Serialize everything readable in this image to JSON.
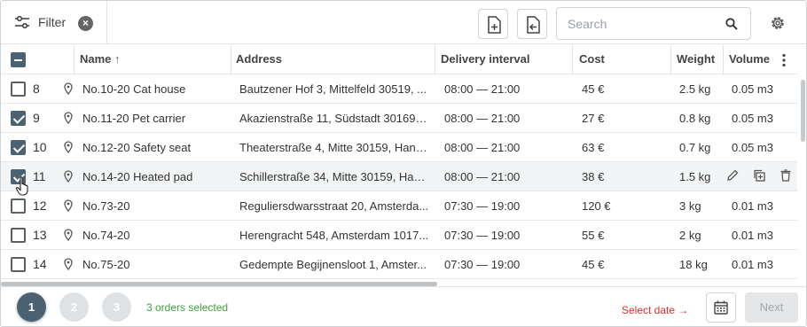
{
  "toolbar": {
    "filter_label": "Filter",
    "filter_clear_icon": "close-circle-icon",
    "search_placeholder": "Search",
    "search_icon": "search-icon",
    "settings_icon": "gear-icon",
    "buttons": [
      "add-document-icon",
      "import-document-icon"
    ]
  },
  "table": {
    "columns": [
      {
        "label": "Name",
        "sort": "↑"
      },
      {
        "label": "Address"
      },
      {
        "label": "Delivery interval"
      },
      {
        "label": "Cost"
      },
      {
        "label": "Weight"
      },
      {
        "label": "Volume"
      }
    ],
    "rows": [
      {
        "num": "8",
        "checked": false,
        "name": "No.10-20 Cat house",
        "address": "Bautzener Hof 3, Mittelfeld 30519, ...",
        "interval": "08:00 — 21:00",
        "cost": "45 €",
        "weight": "2.5 kg",
        "volume": "0.05 m3"
      },
      {
        "num": "9",
        "checked": true,
        "name": "No.11-20 Pet carrier",
        "address": "Akazienstraße 11, Südstadt 30169, ...",
        "interval": "08:00 — 21:00",
        "cost": "27 €",
        "weight": "0.8 kg",
        "volume": "0.05 m3"
      },
      {
        "num": "10",
        "checked": true,
        "name": "No.12-20 Safety seat",
        "address": "Theaterstraße 4, Mitte 30159, Hann...",
        "interval": "08:00 — 21:00",
        "cost": "63 €",
        "weight": "0.7 kg",
        "volume": "0.05 m3"
      },
      {
        "num": "11",
        "checked": true,
        "name": "No.14-20 Heated pad",
        "address": "Schillerstraße 34, Mitte 30159, Han...",
        "interval": "08:00 — 21:00",
        "cost": "38 €",
        "weight": "1.5 kg",
        "volume": ""
      },
      {
        "num": "12",
        "checked": false,
        "name": "No.73-20",
        "address": "Reguliersdwarsstraat 20, Amsterda...",
        "interval": "07:30 — 19:00",
        "cost": "120 €",
        "weight": "3 kg",
        "volume": "0.01 m3"
      },
      {
        "num": "13",
        "checked": false,
        "name": "No.74-20",
        "address": "Herengracht 548, Amsterdam 1017...",
        "interval": "07:30 — 19:00",
        "cost": "55 €",
        "weight": "2 kg",
        "volume": "0.01 m3"
      },
      {
        "num": "14",
        "checked": false,
        "name": "No.75-20",
        "address": "Gedempte Begijnensloot 1, Amster...",
        "interval": "07:30 — 19:00",
        "cost": "45 €",
        "weight": "18 kg",
        "volume": "0.01 m3"
      }
    ],
    "hover_row_actions": [
      "edit-icon",
      "copy-icon",
      "trash-icon"
    ]
  },
  "footer": {
    "steps": [
      "1",
      "2",
      "3"
    ],
    "active_step": "1",
    "orders_selected": "3 orders selected",
    "select_date": "Select date →",
    "calendar_icon": "calendar-icon",
    "next_label": "Next"
  },
  "colors": {
    "accent": "#4a6272",
    "selected_text": "#3aa33a",
    "warning_text": "#e0302a"
  }
}
